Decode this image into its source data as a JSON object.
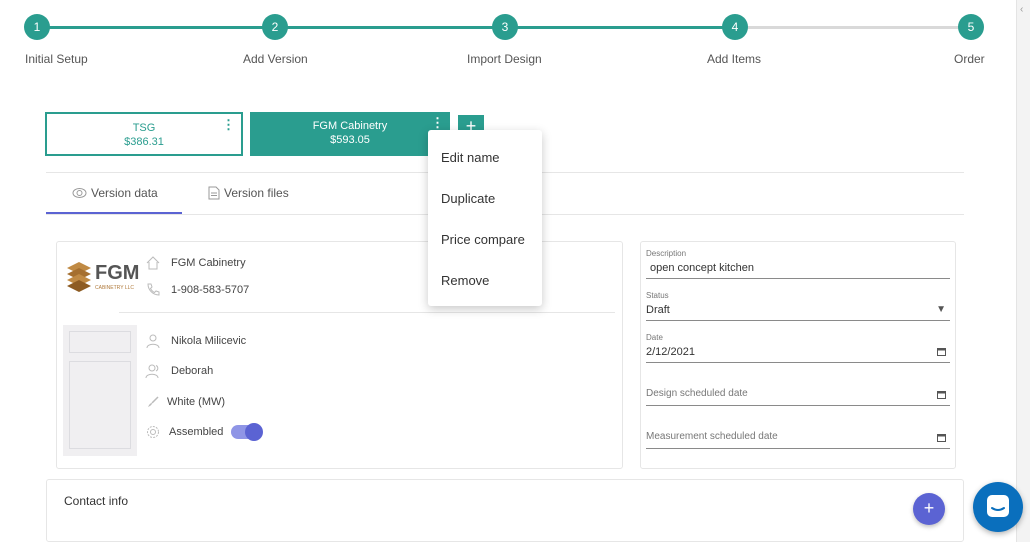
{
  "stepper": {
    "steps": [
      {
        "number": "1",
        "label": "Initial Setup"
      },
      {
        "number": "2",
        "label": "Add Version"
      },
      {
        "number": "3",
        "label": "Import Design"
      },
      {
        "number": "4",
        "label": "Add Items"
      },
      {
        "number": "5",
        "label": "Order"
      }
    ],
    "current_step": 4
  },
  "versions": [
    {
      "name": "TSG",
      "price": "$386.31"
    },
    {
      "name": "FGM Cabinetry",
      "price": "$593.05",
      "selected": true
    }
  ],
  "add_version_label": "+",
  "version_menu": {
    "items": [
      "Edit name",
      "Duplicate",
      "Price compare",
      "Remove"
    ]
  },
  "tabs": [
    {
      "label": "Version data",
      "icon": "coins-icon",
      "active": true
    },
    {
      "label": "Version files",
      "icon": "document-icon"
    }
  ],
  "vendor": {
    "logo_text": "FGM",
    "logo_tagline": "CABINETRY LLC",
    "name": "FGM Cabinetry",
    "phone": "1-908-583-5707"
  },
  "details": {
    "contact_person": "Nikola Milicevic",
    "customer": "Deborah",
    "finish": "White (MW)",
    "assembled_label": "Assembled",
    "assembled": true
  },
  "form": {
    "description_label": "Description",
    "description_value": "open concept kitchen",
    "status_label": "Status",
    "status_value": "Draft",
    "date_label": "Date",
    "date_value": "2/12/2021",
    "design_date_placeholder": "Design scheduled date",
    "measurement_date_placeholder": "Measurement scheduled date"
  },
  "contact_info": {
    "title": "Contact info"
  },
  "fab_label": "+",
  "colors": {
    "primary": "#2a9d8f",
    "accent": "#5b63d3",
    "chat": "#0a6fbd"
  }
}
